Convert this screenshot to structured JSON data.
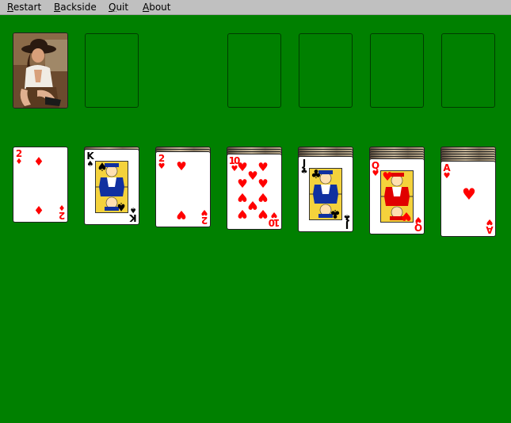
{
  "menu": [
    {
      "first": "R",
      "rest": "estart"
    },
    {
      "first": "B",
      "rest": "ackside"
    },
    {
      "first": "Q",
      "rest": "uit"
    },
    {
      "first": "A",
      "rest": "bout"
    }
  ],
  "colors": {
    "felt": "#008000",
    "menubar": "#c0c0c0",
    "red_suit": "#ff0000"
  },
  "stock": {
    "icon": "photo-card-back"
  },
  "tableau": [
    {
      "hidden": 0,
      "rank": "2",
      "suit": "♦",
      "color": "red"
    },
    {
      "hidden": 1,
      "rank": "K",
      "suit": "♠",
      "color": "black"
    },
    {
      "hidden": 2,
      "rank": "2",
      "suit": "♥",
      "color": "red"
    },
    {
      "hidden": 3,
      "rank": "10",
      "suit": "♥",
      "color": "red"
    },
    {
      "hidden": 4,
      "rank": "J",
      "suit": "♣",
      "color": "black"
    },
    {
      "hidden": 5,
      "rank": "Q",
      "suit": "♥",
      "color": "red"
    },
    {
      "hidden": 6,
      "rank": "A",
      "suit": "♥",
      "color": "red"
    }
  ]
}
